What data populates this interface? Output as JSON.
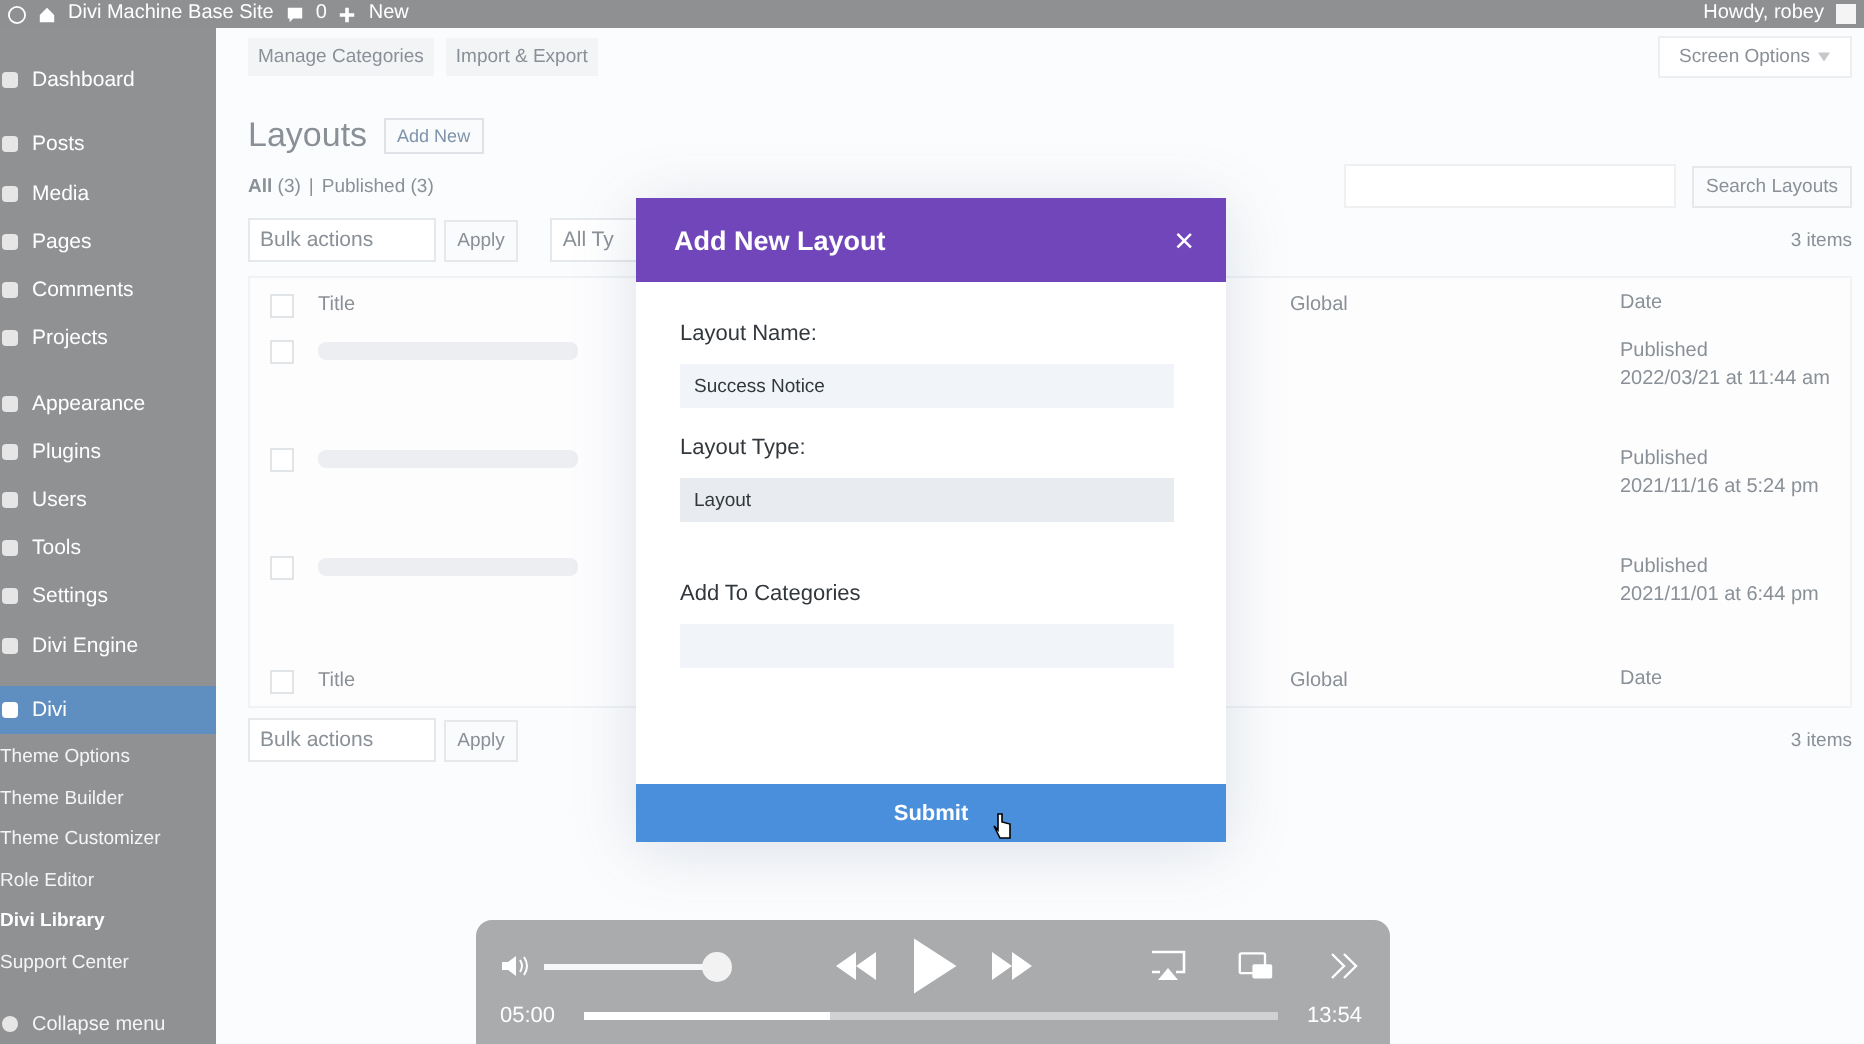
{
  "admin_bar": {
    "site_name": "Divi Machine Base Site",
    "comments_count": "0",
    "new_label": "New",
    "greeting": "Howdy, robey"
  },
  "sidebar": {
    "items": [
      {
        "label": "Dashboard",
        "selected": false
      },
      {
        "label": "Posts",
        "selected": false
      },
      {
        "label": "Media",
        "selected": false
      },
      {
        "label": "Pages",
        "selected": false
      },
      {
        "label": "Comments",
        "selected": false
      },
      {
        "label": "Projects",
        "selected": false
      },
      {
        "label": "Appearance",
        "selected": false
      },
      {
        "label": "Plugins",
        "selected": false
      },
      {
        "label": "Users",
        "selected": false
      },
      {
        "label": "Tools",
        "selected": false
      },
      {
        "label": "Settings",
        "selected": false
      },
      {
        "label": "Divi Engine",
        "selected": false
      },
      {
        "label": "Divi",
        "selected": true,
        "children": [
          {
            "label": "Theme Options",
            "selected": false
          },
          {
            "label": "Theme Builder",
            "selected": false
          },
          {
            "label": "Theme Customizer",
            "selected": false
          },
          {
            "label": "Role Editor",
            "selected": false
          },
          {
            "label": "Divi Library",
            "selected": true
          },
          {
            "label": "Support Center",
            "selected": false
          }
        ]
      }
    ],
    "collapse_label": "Collapse menu"
  },
  "content": {
    "tabs": [
      "Manage Categories",
      "Import & Export"
    ],
    "screen_options": "Screen Options",
    "heading": "Layouts",
    "add_new": "Add New",
    "filters": [
      {
        "label": "All",
        "count": "(3)",
        "selected": true
      },
      {
        "label": "Published",
        "count": "(3)",
        "selected": false
      }
    ],
    "filter_separator": "|",
    "bulk_actions": "Bulk actions",
    "apply": "Apply",
    "type_filter": "All Ty",
    "search_button": "Search Layouts",
    "items_count": "3 items",
    "table": {
      "header_checked": false,
      "footer_checked": false,
      "columns": [
        "Title",
        "Global",
        "Date"
      ],
      "rows": [
        {
          "checked": false,
          "status": "Published",
          "date": "2022/03/21 at 11:44 am"
        },
        {
          "checked": false,
          "status": "Published",
          "date": "2021/11/16 at 5:24 pm"
        },
        {
          "checked": false,
          "status": "Published",
          "date": "2021/11/01 at 6:44 pm"
        }
      ],
      "footer_columns": [
        "Title",
        "Global",
        "Date"
      ]
    },
    "bottom_bulk_actions": "Bulk actions",
    "bottom_apply": "Apply",
    "bottom_items_count": "3 items"
  },
  "modal": {
    "title": "Add New Layout",
    "close": "×",
    "fields": [
      {
        "label": "Layout Name:",
        "kind": "text",
        "value": "Success Notice"
      },
      {
        "label": "Layout Type:",
        "kind": "select",
        "value": "Layout"
      },
      {
        "label": "Add To Categories",
        "kind": "text"
      }
    ],
    "submit": "Submit"
  },
  "player": {
    "volume": {
      "level": 0.95
    },
    "current_time": "05:00",
    "duration": "13:54",
    "progress": {
      "level": 0.35
    }
  }
}
